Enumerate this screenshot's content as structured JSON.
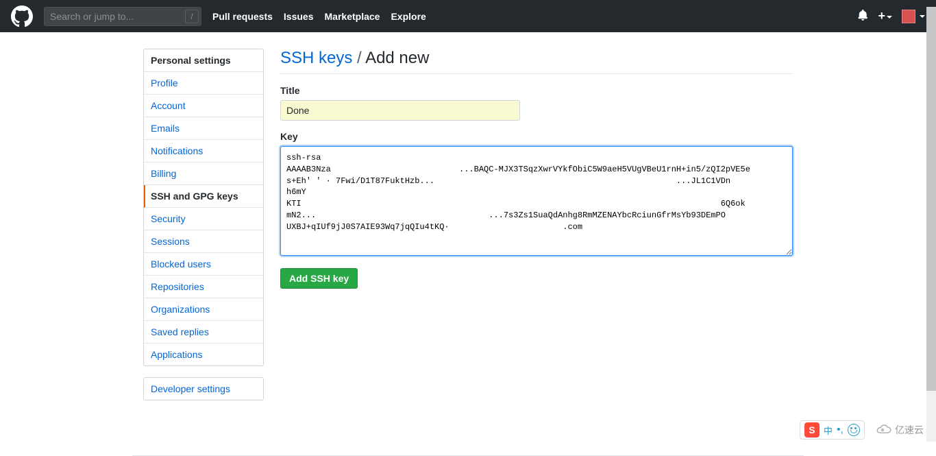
{
  "header": {
    "search_placeholder": "Search or jump to...",
    "slash": "/",
    "nav": {
      "pull_requests": "Pull requests",
      "issues": "Issues",
      "marketplace": "Marketplace",
      "explore": "Explore"
    },
    "plus": "+"
  },
  "sidebar": {
    "header": "Personal settings",
    "items": {
      "profile": "Profile",
      "account": "Account",
      "emails": "Emails",
      "notifications": "Notifications",
      "billing": "Billing",
      "ssh": "SSH and GPG keys",
      "security": "Security",
      "sessions": "Sessions",
      "blocked": "Blocked users",
      "repositories": "Repositories",
      "organizations": "Organizations",
      "saved_replies": "Saved replies",
      "applications": "Applications"
    },
    "developer": "Developer settings"
  },
  "page": {
    "title_link": "SSH keys",
    "title_sep": " / ",
    "title_rest": "Add new",
    "title_label": "Title",
    "key_label": "Key",
    "submit": "Add SSH key"
  },
  "form": {
    "title_value": "Done",
    "key_value": "ssh-rsa\nAAAAB3Nza                          ...BAQC-MJX3TSqzXwrVYkfObiC5W9aeH5VUgVBeU1rnH+in5/zQI2pVE5e\ns+Eh' ' · 7Fwi/D1T87FuktHzb...                                                 ...JL1C1VDn           h6mY\nKTI                                                                                     6Q6ok\nmN2...                                   ...7s3Zs1SuaQdAnhg8RmMZENAYbcRciunGfrMsYb93DEmPO\nUXBJ+qIUf9jJ0S7AIE93Wq7jqQIu4tKQ·                       .com"
  },
  "badges": {
    "cn": "中",
    "yisu": "亿速云"
  }
}
